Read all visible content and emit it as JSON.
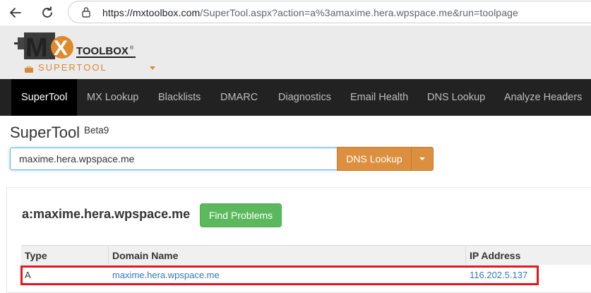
{
  "browser": {
    "url_host": "https://mxtoolbox.com",
    "url_rest": "/SuperTool.aspx?action=a%3amaxime.hera.wpspace.me&run=toolpage"
  },
  "logo": {
    "mark": "MX",
    "text": "TOOLBOX",
    "tm": "®"
  },
  "product": {
    "label": "SUPERTOOL"
  },
  "nav": {
    "items": [
      {
        "label": "SuperTool"
      },
      {
        "label": "MX Lookup"
      },
      {
        "label": "Blacklists"
      },
      {
        "label": "DMARC"
      },
      {
        "label": "Diagnostics"
      },
      {
        "label": "Email Health"
      },
      {
        "label": "DNS Lookup"
      },
      {
        "label": "Analyze Headers"
      }
    ]
  },
  "page": {
    "title": "SuperTool",
    "beta": "Beta9"
  },
  "search": {
    "value": "maxime.hera.wpspace.me",
    "button_label": "DNS Lookup"
  },
  "result": {
    "heading": "a:maxime.hera.wpspace.me",
    "find_button": "Find Problems",
    "columns": [
      "Type",
      "Domain Name",
      "IP Address"
    ],
    "rows": [
      {
        "type": "A",
        "domain": "maxime.hera.wpspace.me",
        "ip": "116.202.5.137"
      }
    ]
  },
  "colors": {
    "accent": "#db8f3f",
    "nav_bg": "#222222",
    "success": "#5cb85c",
    "link": "#337ab7",
    "highlight": "#e8141b"
  }
}
